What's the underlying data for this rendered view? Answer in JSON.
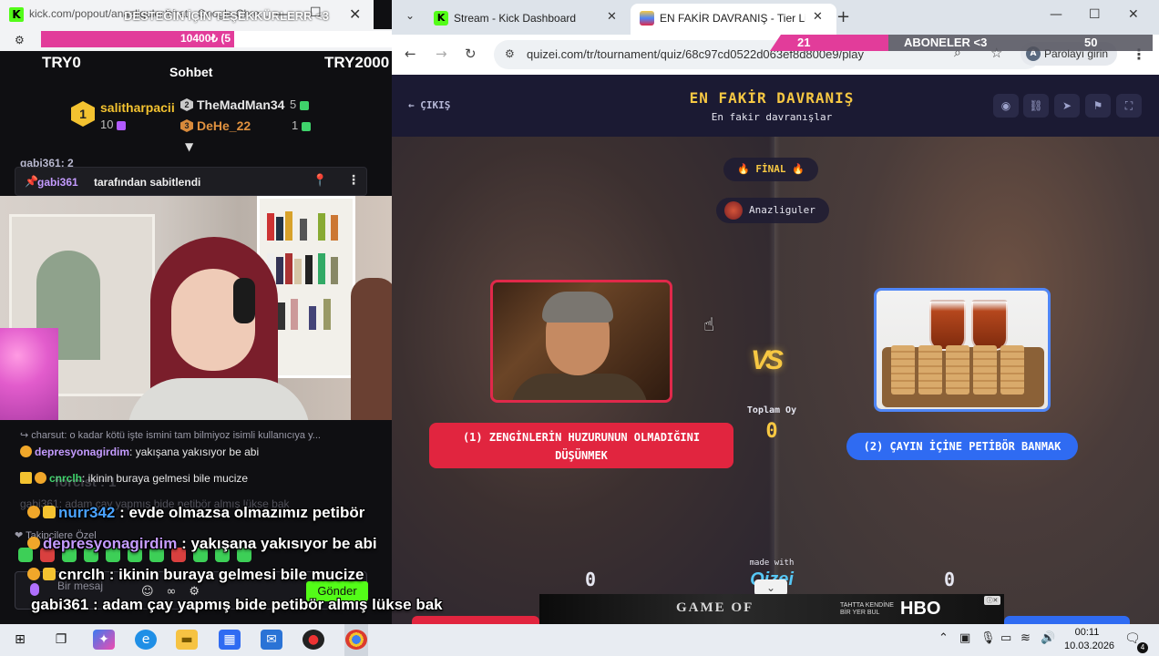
{
  "popup": {
    "url": "kick.com/popout/anazliguler/chat - Google Chro...",
    "overlay_text": "DESTEĞİN İÇİN TEŞEKKÜRLERR <3",
    "goal_text": "10400₺ (5",
    "goal_progress": 0.55
  },
  "chat": {
    "try_left": "TRY0",
    "title": "Sohbet",
    "try_right": "TRY2000",
    "leaderboard": [
      {
        "rank": "1",
        "name": "salitharpacii",
        "count": "10"
      },
      {
        "rank": "2",
        "name": "TheMadMan34",
        "count": "5"
      },
      {
        "rank": "3",
        "name": "DeHe_22",
        "count": "1"
      }
    ],
    "peek_msg": "gabi361: 2",
    "pinned": {
      "user": "gabi361",
      "text": "tarafından sabitlendi"
    },
    "reply_line": "↪ charsut: o kadar kötü işte ismini tam bilmiyoz isimli kullanıcıya y...",
    "messages": [
      {
        "user": "depresyonagirdim",
        "text": ": yakışana yakısıyor be abi",
        "color": "#c49bff"
      },
      {
        "user": "cnrclh",
        "text": ": ikinin buraya gelmesi bile mucize",
        "color": "#3fd26b"
      }
    ],
    "ghost_name": "forcist : 1",
    "ghost_msg": "gabi361: adam çay yapmış bide petibör almış lükse bak",
    "followers_only": "❤ Takipçilere Özel",
    "input_placeholder": "Bir mesaj",
    "send_label": "Gönder"
  },
  "overlay_chat": [
    {
      "user": "nurr342",
      "text": " : evde olmazsa olmazımız petibör",
      "color": "#4aa3ff"
    },
    {
      "user": "depresyonagirdim",
      "text": " : yakışana yakısıyor be abi",
      "color": "#c49bff"
    },
    {
      "user": "cnrclh",
      "text": " : ikinin buraya gelmesi bile mucize",
      "color": "#ffffff"
    },
    {
      "user": "gabi361",
      "text": " : adam çay yapmış bide petibör almış lükse bak",
      "color": "#ffffff"
    }
  ],
  "browser": {
    "tabs": [
      {
        "title": "Stream - Kick Dashboard",
        "icon": "kick-icon"
      },
      {
        "title": "EN FAKİR DAVRANIŞ - Tier List,",
        "icon": "quizei-icon"
      }
    ],
    "url": "quizei.com/tr/tournament/quiz/68c97cd0522d063ef8d800e9/play",
    "password_chip": "Parolayı girin"
  },
  "sub_goal": {
    "current": "21",
    "label": "ABONELER <3",
    "target": "50",
    "progress": 0.42
  },
  "quiz": {
    "exit": "← ÇIKIŞ",
    "title": "EN FAKİR DAVRANIŞ",
    "subtitle": "En fakir davranışlar",
    "round": "🔥 FİNAL 🔥",
    "host": "Anazliguler",
    "vs": "VS",
    "total_label": "Toplam Oy",
    "total_value": "0",
    "choice_left": "(1) ZENGİNLERİN HUZURUNUN OLMADIĞINI DÜŞÜNMEK",
    "choice_right": "(2) ÇAYIN İÇİNE PETİBÖR BANMAK",
    "score_left": "0",
    "score_right": "0",
    "made_with": "made with",
    "made_logo": "Qizei"
  },
  "ad": {
    "show": "GAME OF",
    "tagline": "TAHTTA KENDİNE BİR YER BUL",
    "brand": "HBO"
  },
  "taskbar": {
    "time": "00:11",
    "date": "10.03.2026",
    "notif_count": "4"
  }
}
